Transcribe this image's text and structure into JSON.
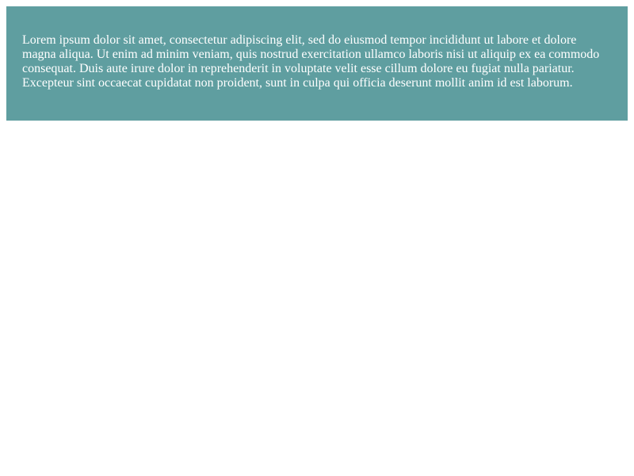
{
  "colors": {
    "panel_background": "#5f9ea0",
    "panel_text": "#ffffff",
    "page_background": "#ffffff"
  },
  "panel": {
    "text": "Lorem ipsum dolor sit amet, consectetur adipiscing elit, sed do eiusmod tempor incididunt ut labore et dolore magna aliqua. Ut enim ad minim veniam, quis nostrud exercitation ullamco laboris nisi ut aliquip ex ea commodo consequat. Duis aute irure dolor in reprehenderit in voluptate velit esse cillum dolore eu fugiat nulla pariatur. Excepteur sint occaecat cupidatat non proident, sunt in culpa qui officia deserunt mollit anim id est laborum."
  }
}
